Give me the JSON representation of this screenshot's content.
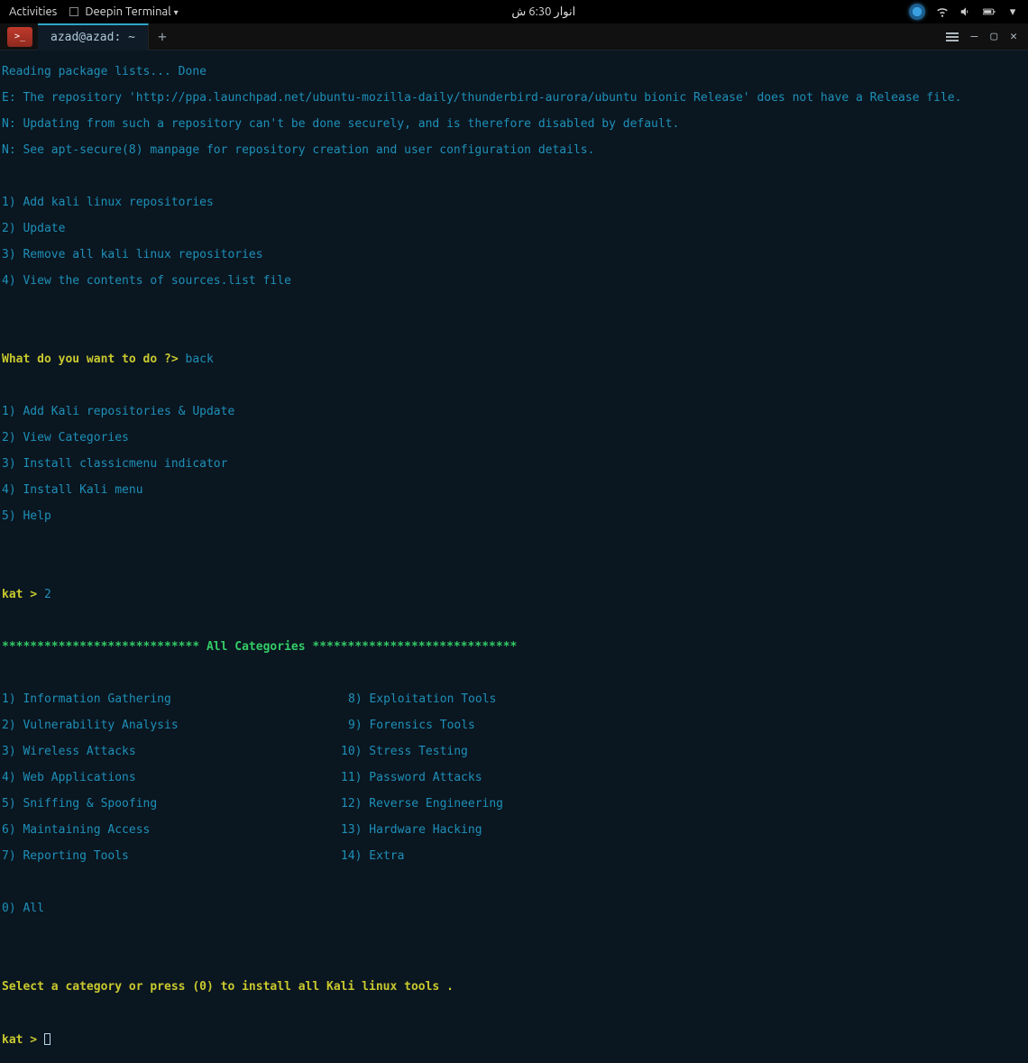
{
  "topbar": {
    "activities": "Activities",
    "app_menu": "Deepin Terminal",
    "clock": "انوار  6:30 ش"
  },
  "window": {
    "tab_title": "azad@azad: ~",
    "add_tab": "+"
  },
  "term": {
    "reading": "Reading package lists... Done",
    "err_e": "E: The repository 'http://ppa.launchpad.net/ubuntu-mozilla-daily/thunderbird-aurora/ubuntu bionic Release' does not have a Release file.",
    "err_n1": "N: Updating from such a repository can't be done securely, and is therefore disabled by default.",
    "err_n2": "N: See apt-secure(8) manpage for repository creation and user configuration details.",
    "menu1": {
      "i1": "1) Add kali linux repositories",
      "i2": "2) Update",
      "i3": "3) Remove all kali linux repositories",
      "i4": "4) View the contents of sources.list file"
    },
    "prompt1_q": "What do you want to do ?>",
    "prompt1_a": " back",
    "menu2": {
      "i1": "1) Add Kali repositories & Update",
      "i2": "2) View Categories",
      "i3": "3) Install classicmenu indicator",
      "i4": "4) Install Kali menu",
      "i5": "5) Help"
    },
    "kat1_p": "kat >",
    "kat1_a": " 2",
    "cats_header": "**************************** All Categories *****************************",
    "cats": {
      "l1": "1) Information Gathering",
      "r1": "8) Exploitation Tools",
      "l2": "2) Vulnerability Analysis",
      "r2": "9) Forensics Tools",
      "l3": "3) Wireless Attacks",
      "r3": "10) Stress Testing",
      "l4": "4) Web Applications",
      "r4": "11) Password Attacks",
      "l5": "5) Sniffing & Spoofing",
      "r5": "12) Reverse Engineering",
      "l6": "6) Maintaining Access",
      "r6": "13) Hardware Hacking",
      "l7": "7) Reporting Tools",
      "r7": "14) Extra",
      "all": "0) All"
    },
    "select_prompt": "Select a category or press (0) to install all Kali linux tools .",
    "kat2_p": "kat >",
    "kat2_a": " "
  }
}
